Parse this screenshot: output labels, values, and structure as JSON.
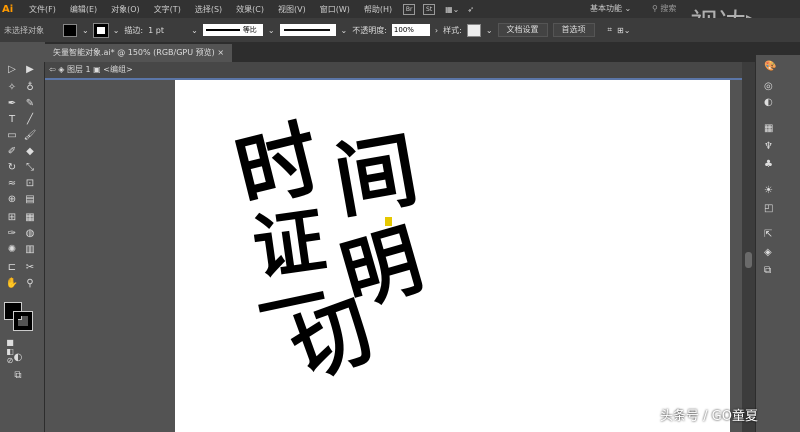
{
  "app": {
    "logo": "Ai"
  },
  "menu": [
    "文件(F)",
    "编辑(E)",
    "对象(O)",
    "文字(T)",
    "选择(S)",
    "效果(C)",
    "视图(V)",
    "窗口(W)",
    "帮助(H)"
  ],
  "bridge": [
    "Br",
    "St"
  ],
  "workspace": "基本功能 ⌄",
  "search_placeholder": "搜索",
  "control": {
    "selection": "未选择对象",
    "stroke_label": "描边:",
    "stroke_weight": "1 pt",
    "stroke_profile": "等比",
    "opacity_label": "不透明度:",
    "opacity": "100%",
    "style_label": "样式:",
    "doc_setup": "文档设置",
    "preferences": "首选项"
  },
  "tab": {
    "title": "矢量智能对象.ai* @ 150% (RGB/GPU 预览)",
    "close": "×"
  },
  "breadcrumb": {
    "layer": "图层 1",
    "group": "<编组>"
  },
  "artwork": [
    "时",
    "间",
    "证",
    "明",
    "一",
    "切"
  ],
  "watermark": "头条号 / GO童夏",
  "corner_watermark": "视达▷"
}
